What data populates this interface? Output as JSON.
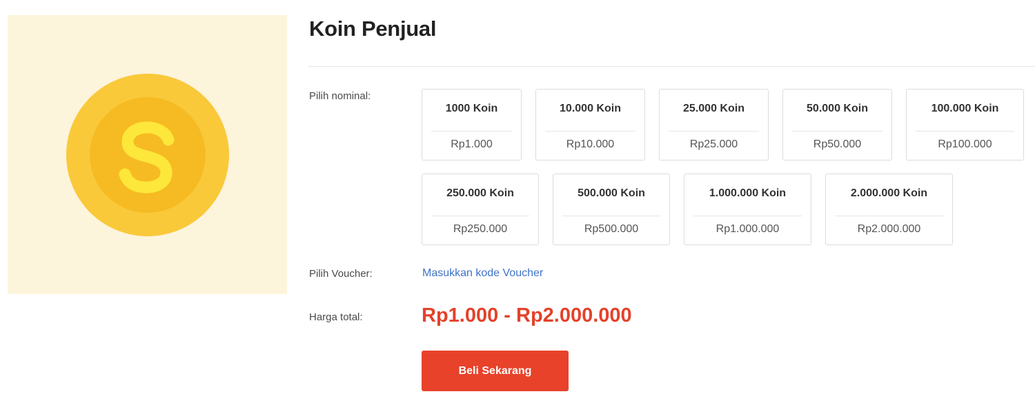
{
  "product": {
    "title": "Koin Penjual",
    "image_icon": "coin-s-icon",
    "colors": {
      "image_bg": "#fdf4dc",
      "coin_outer": "#f9c93a",
      "coin_inner": "#f6bb22",
      "coin_letter": "#fde73a"
    }
  },
  "nominal": {
    "label": "Pilih nominal:",
    "options": [
      {
        "name": "1000 Koin",
        "price": "Rp1.000"
      },
      {
        "name": "10.000 Koin",
        "price": "Rp10.000"
      },
      {
        "name": "25.000 Koin",
        "price": "Rp25.000"
      },
      {
        "name": "50.000 Koin",
        "price": "Rp50.000"
      },
      {
        "name": "100.000 Koin",
        "price": "Rp100.000"
      },
      {
        "name": "250.000 Koin",
        "price": "Rp250.000"
      },
      {
        "name": "500.000 Koin",
        "price": "Rp500.000"
      },
      {
        "name": "1.000.000 Koin",
        "price": "Rp1.000.000"
      },
      {
        "name": "2.000.000 Koin",
        "price": "Rp2.000.000"
      }
    ]
  },
  "voucher": {
    "label": "Pilih Voucher:",
    "link_text": "Masukkan kode Voucher"
  },
  "total": {
    "label": "Harga total:",
    "value": "Rp1.000 - Rp2.000.000"
  },
  "buy_button": {
    "label": "Beli Sekarang",
    "color": "#e8422b"
  }
}
